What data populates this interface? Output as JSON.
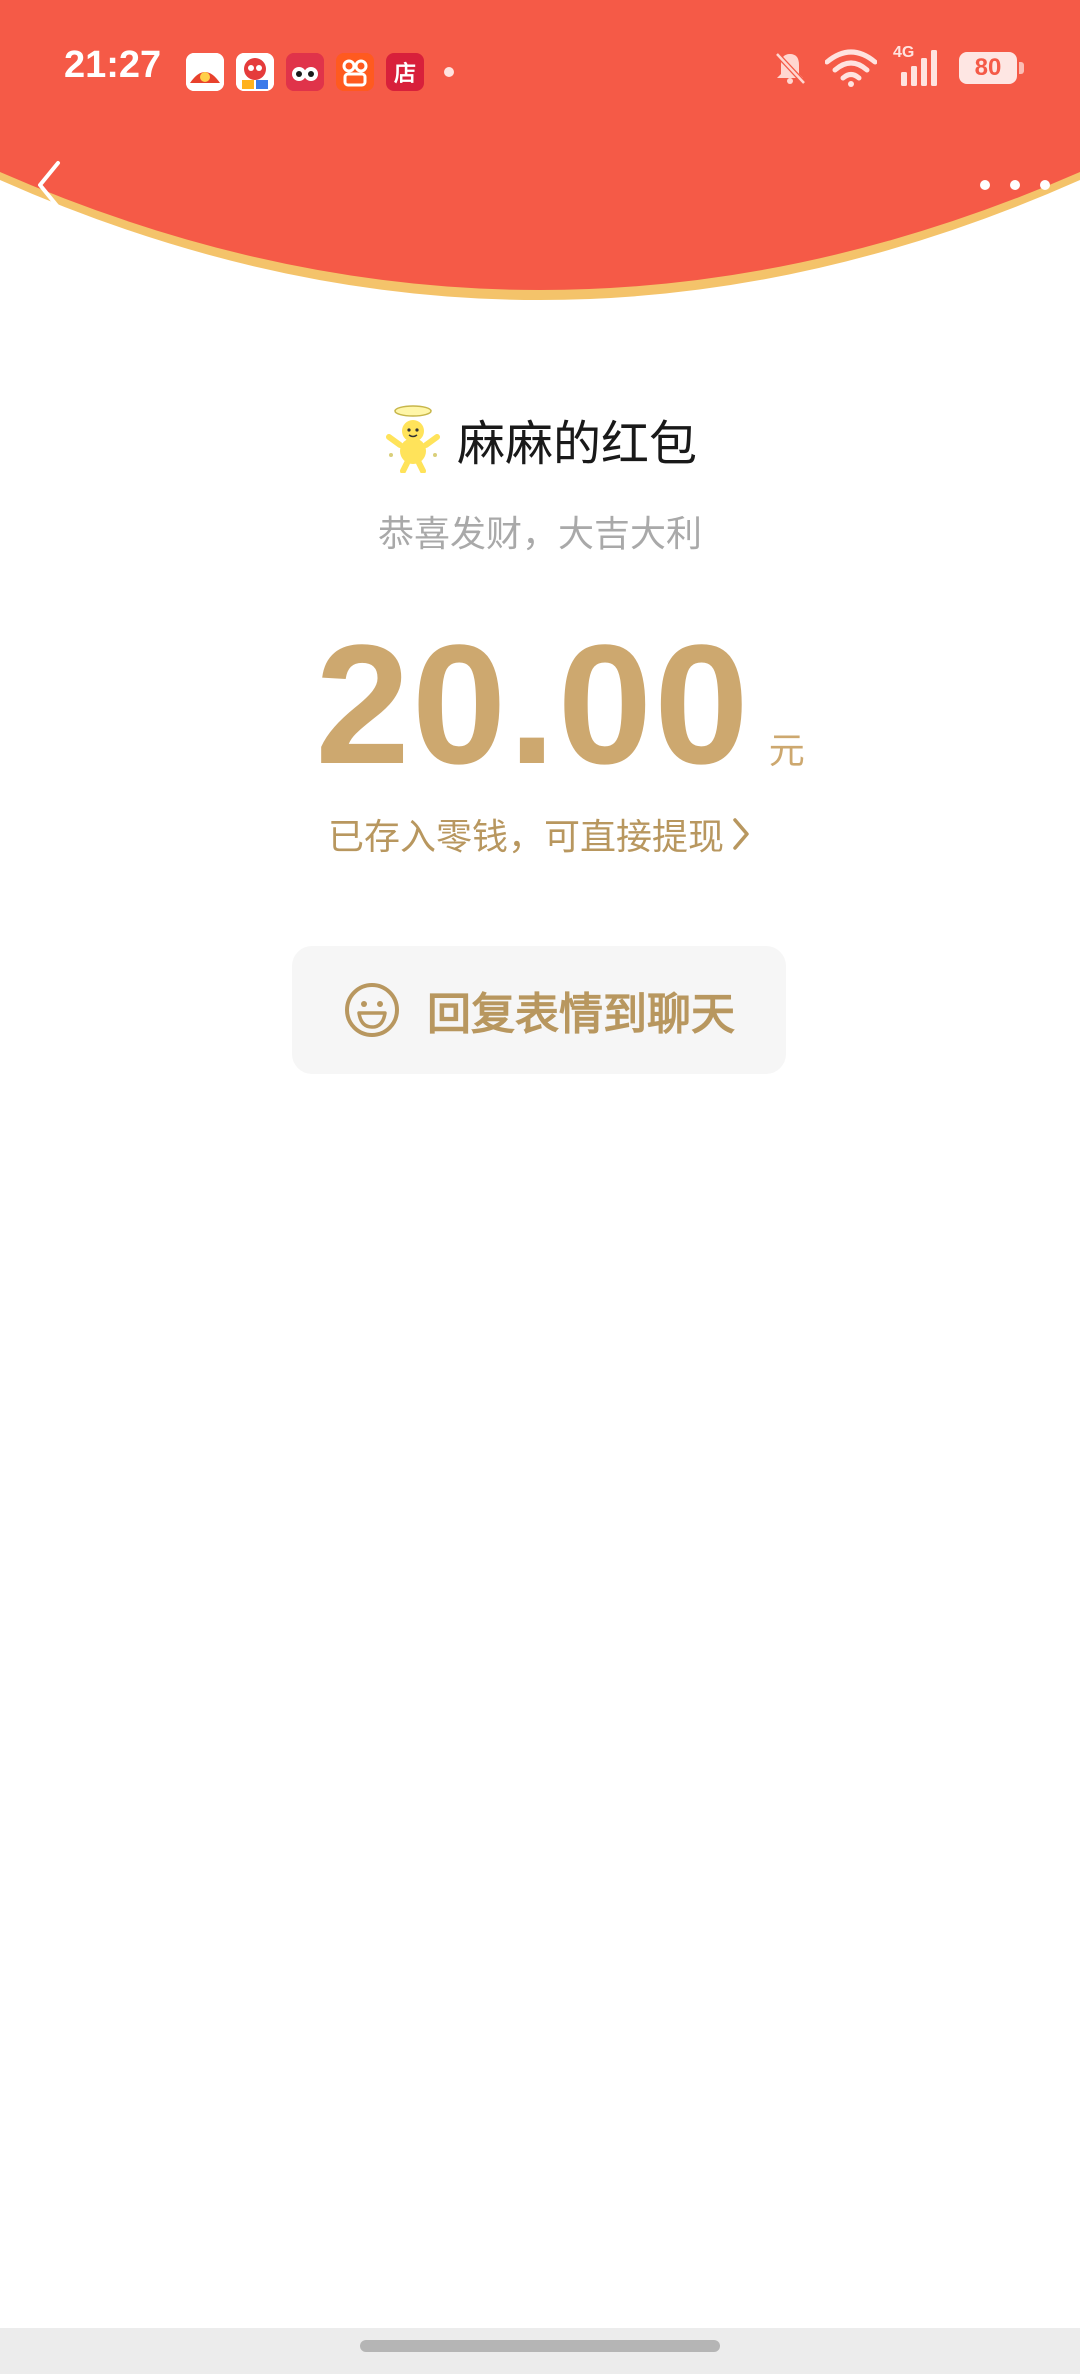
{
  "status_bar": {
    "time": "21:27",
    "notification_apps": [
      {
        "icon": "weibo-like-app-icon",
        "color": "#e8412c"
      },
      {
        "icon": "mascot-app-icon",
        "color": "#e53b3b"
      },
      {
        "icon": "video-app-icon",
        "color": "#e0334a"
      },
      {
        "icon": "kuaishou-app-icon",
        "color": "#ff5a1f"
      },
      {
        "icon": "store-app-icon",
        "color": "#d8203b",
        "label": "店"
      }
    ],
    "network_type": "4G",
    "battery_level": "80"
  },
  "nav": {
    "back_icon": "chevron-left-icon",
    "more_icon": "more-dots-icon"
  },
  "red_packet": {
    "sender_name": "麻麻的红包",
    "greeting": "恭喜发财，大吉大利",
    "amount": "20.00",
    "currency_unit": "元",
    "balance_note": "已存入零钱，可直接提现",
    "balance_chevron": "›"
  },
  "reply": {
    "label": "回复表情到聊天",
    "icon": "smiley-icon"
  },
  "colors": {
    "header_red": "#f55a47",
    "header_rim": "#f4c36a",
    "gold_text": "#cda86f",
    "gold_text_dark": "#b8975f",
    "grey_text": "#a9a9a9",
    "button_bg": "#f6f6f6"
  }
}
